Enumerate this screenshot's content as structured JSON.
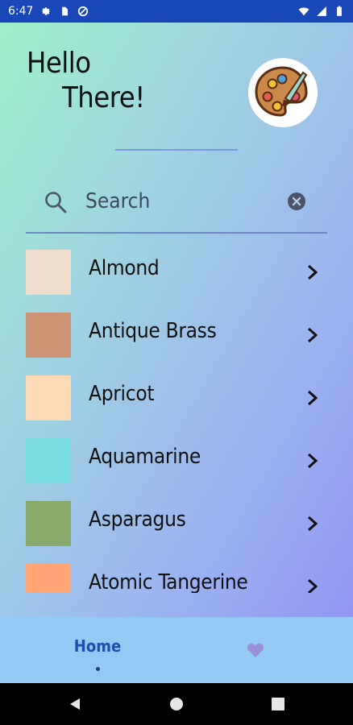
{
  "status_bar": {
    "time": "6:47"
  },
  "greeting": {
    "line1": "Hello",
    "line2": "There!"
  },
  "search": {
    "placeholder": "Search"
  },
  "colors": [
    {
      "label": "Almond",
      "hex": "#EFDECD"
    },
    {
      "label": "Antique Brass",
      "hex": "#CD9575"
    },
    {
      "label": "Apricot",
      "hex": "#FDD9B5"
    },
    {
      "label": "Aquamarine",
      "hex": "#78DBE2"
    },
    {
      "label": "Asparagus",
      "hex": "#87A96B"
    },
    {
      "label": "Atomic Tangerine",
      "hex": "#FFA474"
    }
  ],
  "bottom_nav": {
    "home_label": "Home"
  },
  "theme": {
    "status_bar": "#1a47b8",
    "nav_bg": "#93c9f3",
    "accent": "#1f4fae",
    "heart": "#9a8fd6"
  }
}
